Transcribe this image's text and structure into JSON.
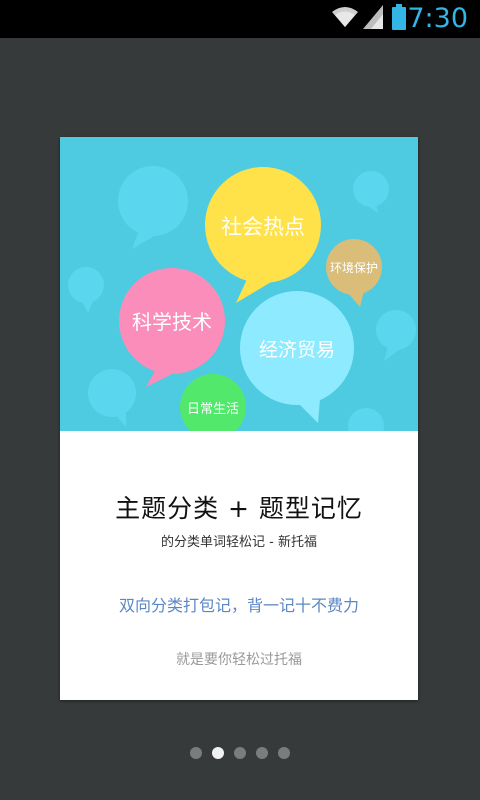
{
  "status_bar": {
    "time": "7:30",
    "icons": [
      "wifi-icon",
      "signal-icon",
      "battery-icon"
    ],
    "accent_color": "#33b5e5"
  },
  "illustration": {
    "background_color": "#4ecbe1",
    "bubbles": [
      {
        "name": "social-hot-topics",
        "label": "社会热点",
        "color": "#ffe14a"
      },
      {
        "name": "environment",
        "label": "环境保护",
        "color": "#d9bd79"
      },
      {
        "name": "science-tech",
        "label": "科学技术",
        "color": "#fb8dba"
      },
      {
        "name": "economy-trade",
        "label": "经济贸易",
        "color": "#8eeaff"
      },
      {
        "name": "daily-life",
        "label": "日常生活",
        "color": "#52e86c"
      }
    ]
  },
  "content": {
    "headline": "主题分类 + 题型记忆",
    "subline": "的分类单词轻松记 - 新托福",
    "tagline": "双向分类打包记，背一记十不费力",
    "footer_note": "就是要你轻松过托福"
  },
  "pager": {
    "total": 5,
    "active_index": 1
  }
}
